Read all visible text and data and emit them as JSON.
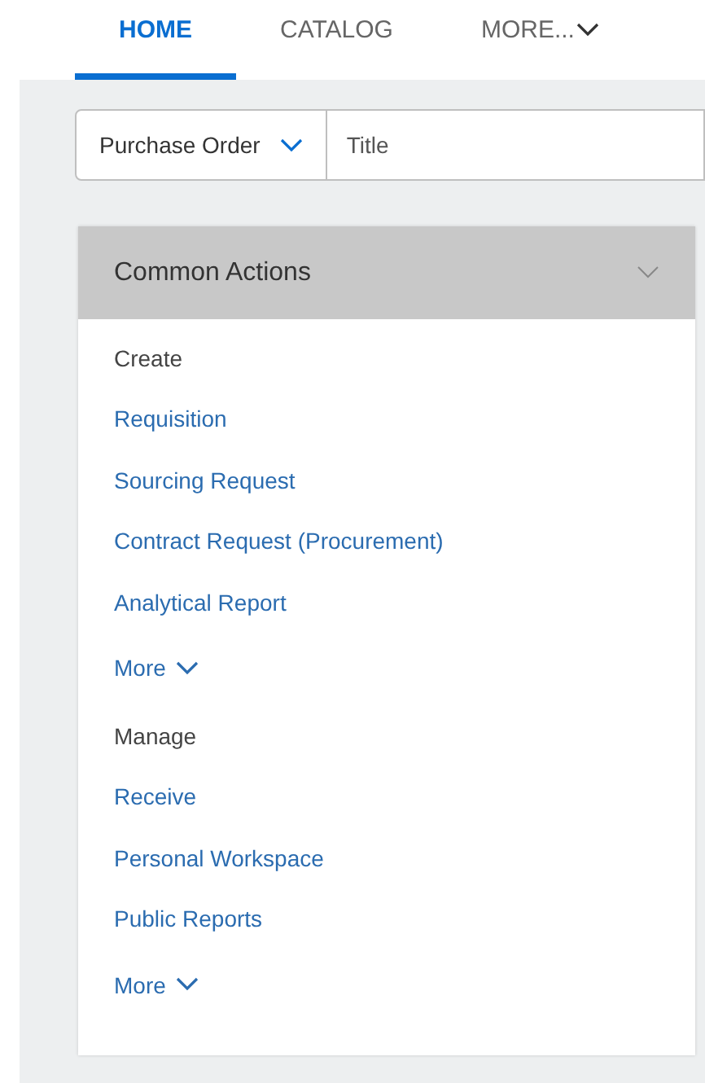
{
  "tabs": [
    {
      "label": "HOME",
      "selected": true,
      "caret": false
    },
    {
      "label": "CATALOG",
      "selected": false,
      "caret": false
    },
    {
      "label": "MORE...",
      "selected": false,
      "caret": true
    }
  ],
  "search": {
    "type_value": "Purchase Order",
    "placeholder": "Title"
  },
  "card": {
    "title": "Common Actions",
    "expanded": true,
    "sections": [
      {
        "heading": "Create",
        "links": [
          "Requisition",
          "Sourcing Request",
          "Contract Request (Procurement)",
          "Analytical Report"
        ],
        "more": "More"
      },
      {
        "heading": "Manage",
        "links": [
          "Receive",
          "Personal Workspace",
          "Public Reports"
        ],
        "more": "More"
      }
    ]
  }
}
